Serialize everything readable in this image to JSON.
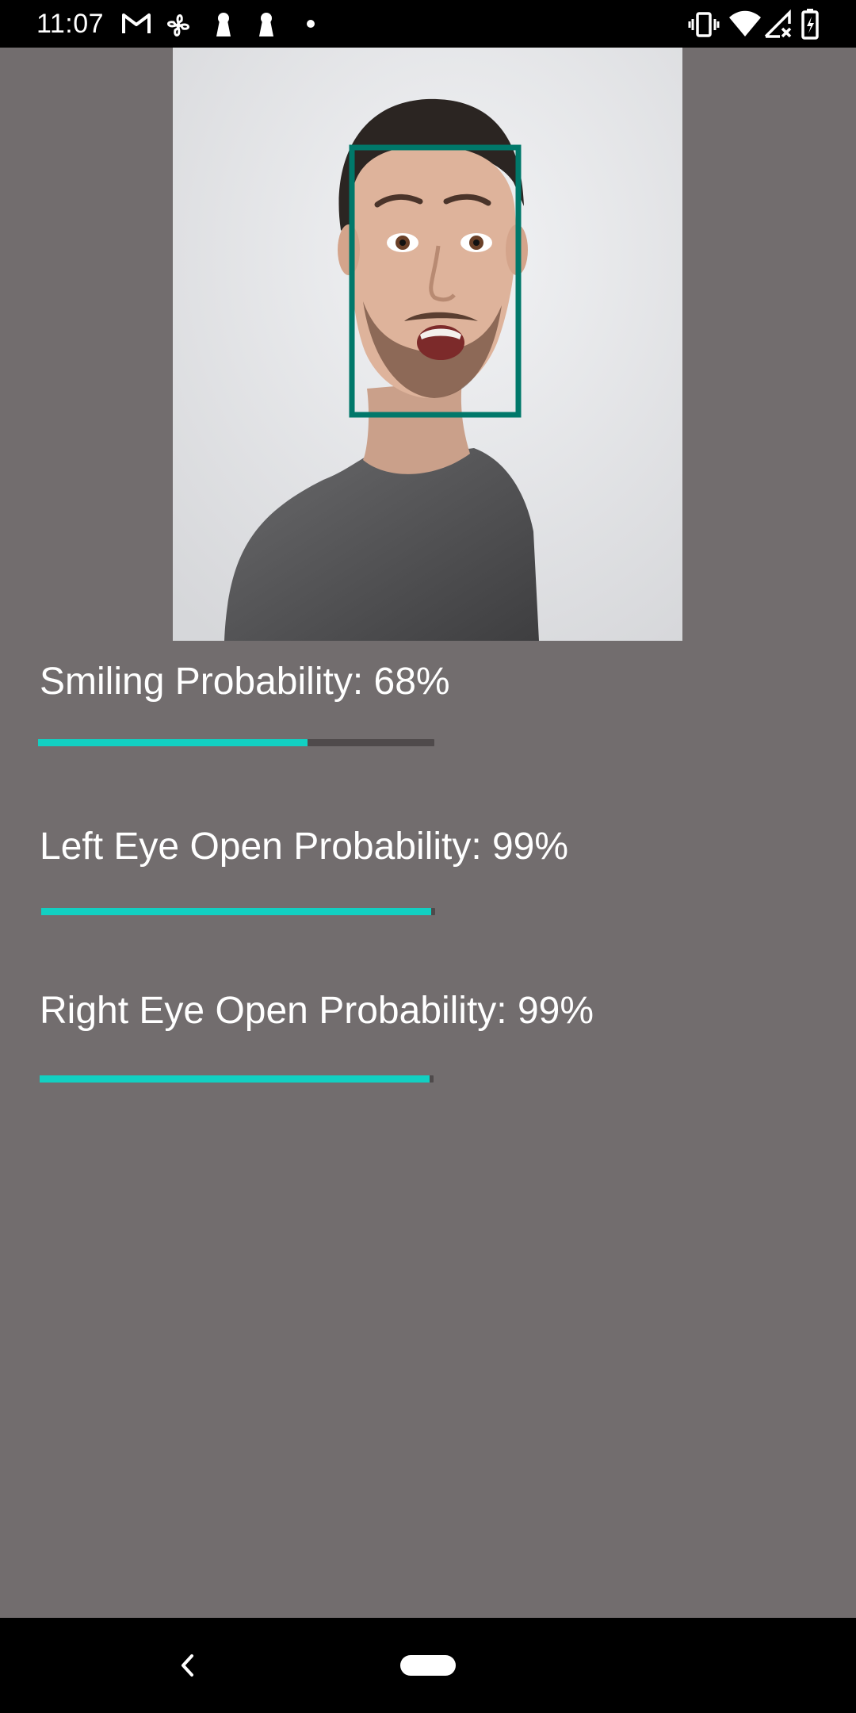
{
  "status_bar": {
    "time": "11:07",
    "left_icons": [
      "gmail-icon",
      "fan-icon",
      "keyhole-icon",
      "keyhole-icon",
      "dot-icon"
    ],
    "right_icons": [
      "vibrate-icon",
      "wifi-icon",
      "no-signal-icon",
      "battery-charging-icon"
    ]
  },
  "face_detection": {
    "box_color": "#00786a"
  },
  "metrics": [
    {
      "label": "Smiling Probability: 68%",
      "value": 0.68
    },
    {
      "label": "Left Eye Open Probability: 99%",
      "value": 0.99
    },
    {
      "label": "Right Eye Open Probability: 99%",
      "value": 0.99
    }
  ],
  "colors": {
    "background": "#726d6e",
    "progress_fill": "#12d0c2",
    "progress_track": "#4f4a4b"
  },
  "nav_bar": {
    "icons": [
      "back-icon",
      "home-pill-icon"
    ]
  }
}
